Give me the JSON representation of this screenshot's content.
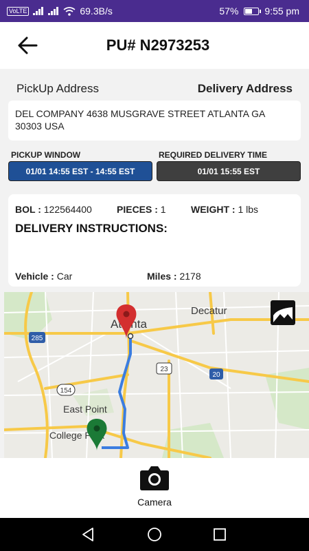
{
  "status_bar": {
    "carrier_badge": "VoLTE",
    "network_speed": "69.3B/s",
    "battery_percent": "57%",
    "time": "9:55 pm",
    "battery_level": 0.57
  },
  "header": {
    "title": "PU# N2973253"
  },
  "addresses": {
    "pickup_label": "PickUp Address",
    "delivery_label": "Delivery Address",
    "address_text": "DEL COMPANY 4638  MUSGRAVE STREET  ATLANTA GA 30303 USA"
  },
  "windows": {
    "pickup_label": "PICKUP WINDOW",
    "pickup_value": "01/01 14:55 EST - 14:55 EST",
    "delivery_label": "REQUIRED DELIVERY TIME",
    "delivery_value": "01/01 15:55 EST",
    "pickup_color": "#1f5096",
    "delivery_color": "#3f3f3f"
  },
  "details": {
    "bol_label": "BOL :",
    "bol_value": "122564400",
    "pieces_label": "PIECES :",
    "pieces_value": "1",
    "weight_label": "WEIGHT :",
    "weight_value": "1 lbs",
    "instructions_label": "DELIVERY INSTRUCTIONS:",
    "vehicle_label": "Vehicle :",
    "vehicle_value": "Car",
    "miles_label": "Miles :",
    "miles_value": "2178"
  },
  "map": {
    "labels": {
      "atlanta": "Atlanta",
      "decatur": "Decatur",
      "east_point": "East Point",
      "college_park": "College Park"
    },
    "shields": {
      "i285": "285",
      "us23": "23",
      "i20": "20",
      "r154": "154"
    },
    "route_color": "#3b7de0",
    "destination_pin_color": "#d32f2f",
    "origin_pin_color": "#1b7a36",
    "gallery_icon": "image-icon"
  },
  "bottom": {
    "camera_label": "Camera",
    "camera_icon": "camera-icon"
  },
  "navbar": {
    "back_icon": "triangle-back-icon",
    "home_icon": "circle-home-icon",
    "recents_icon": "square-recents-icon"
  }
}
